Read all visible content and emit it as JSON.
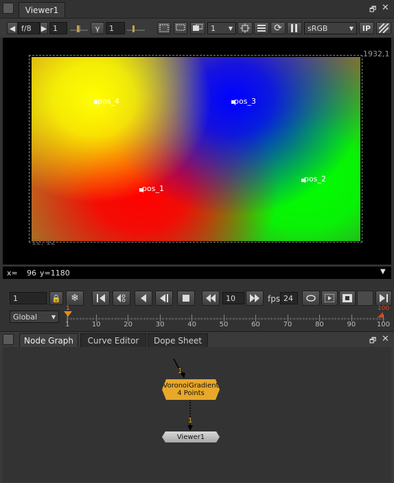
{
  "viewer_panel": {
    "tab_label": "Viewer1",
    "toolbar": {
      "fstop": "f/8",
      "frame_step": "1",
      "gamma_label": "γ",
      "gamma_value": "1",
      "downscale": "1",
      "colorspace": "sRGB",
      "ip_label": "IP"
    },
    "canvas": {
      "format_top_right": "1932,1",
      "format_bottom_left": "12, 12",
      "points": [
        {
          "label": "pos_4"
        },
        {
          "label": "pos_3"
        },
        {
          "label": "pos_1"
        },
        {
          "label": "pos_2"
        }
      ],
      "gradient_colors": {
        "pos_1": "#ff0000",
        "pos_2": "#00ff00",
        "pos_3": "#0000ff",
        "pos_4": "#ffff00"
      }
    },
    "info_bar": {
      "x_label": "x=",
      "x_value": "96",
      "y_label": "y=1180"
    },
    "playback": {
      "current_frame": "1",
      "skip_value": "10",
      "fps_label": "fps",
      "fps_value": "24"
    },
    "timeline": {
      "range_mode": "Global",
      "ticks": [
        "1",
        "10",
        "20",
        "30",
        "40",
        "50",
        "60",
        "70",
        "80",
        "90",
        "100"
      ],
      "in_marker": "1",
      "out_marker": "100"
    }
  },
  "graph_panel": {
    "tabs": [
      {
        "label": "Node Graph"
      },
      {
        "label": "Curve Editor"
      },
      {
        "label": "Dope Sheet"
      }
    ],
    "nodes": {
      "voronoi": {
        "title": "VoronoiGradient",
        "subtitle": "4 Points",
        "input_label": "1",
        "color": "#e8a82a"
      },
      "viewer": {
        "title": "Viewer1",
        "input_label": "1"
      }
    }
  }
}
